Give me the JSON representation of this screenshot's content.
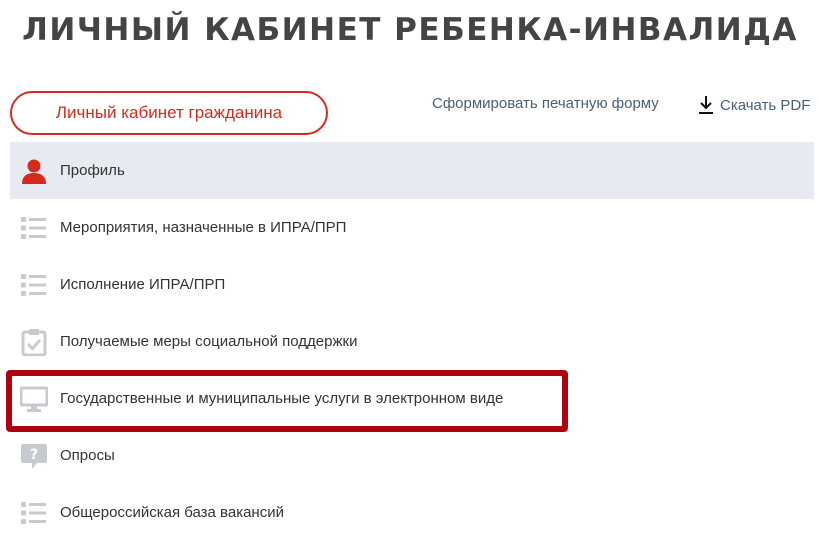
{
  "page": {
    "title": "ЛИЧНЫЙ КАБИНЕТ РЕБЕНКА-ИНВАЛИДА"
  },
  "header": {
    "cabinet_button": "Личный кабинет гражданина",
    "print_form_link": "Сформировать печатную форму",
    "pdf_link": "Скачать PDF"
  },
  "menu": {
    "items": [
      {
        "label": "Профиль",
        "icon": "user-icon",
        "active": true
      },
      {
        "label": "Мероприятия, назначенные в ИПРА/ПРП",
        "icon": "list-icon"
      },
      {
        "label": "Исполнение ИПРА/ПРП",
        "icon": "list-icon"
      },
      {
        "label": "Получаемые меры социальной поддержки",
        "icon": "clipboard-check-icon"
      },
      {
        "label": "Государственные и муниципальные услуги в электронном виде",
        "icon": "monitor-icon",
        "highlighted": true
      },
      {
        "label": "Опросы",
        "icon": "question-bubble-icon"
      },
      {
        "label": "Общероссийская база вакансий",
        "icon": "list-icon"
      }
    ]
  },
  "colors": {
    "accent": "#d52b1e",
    "link": "#4a6076",
    "active_bg": "#e8eaf1",
    "icon_gray": "#c7cbcf",
    "highlight_border": "#b0000f"
  }
}
